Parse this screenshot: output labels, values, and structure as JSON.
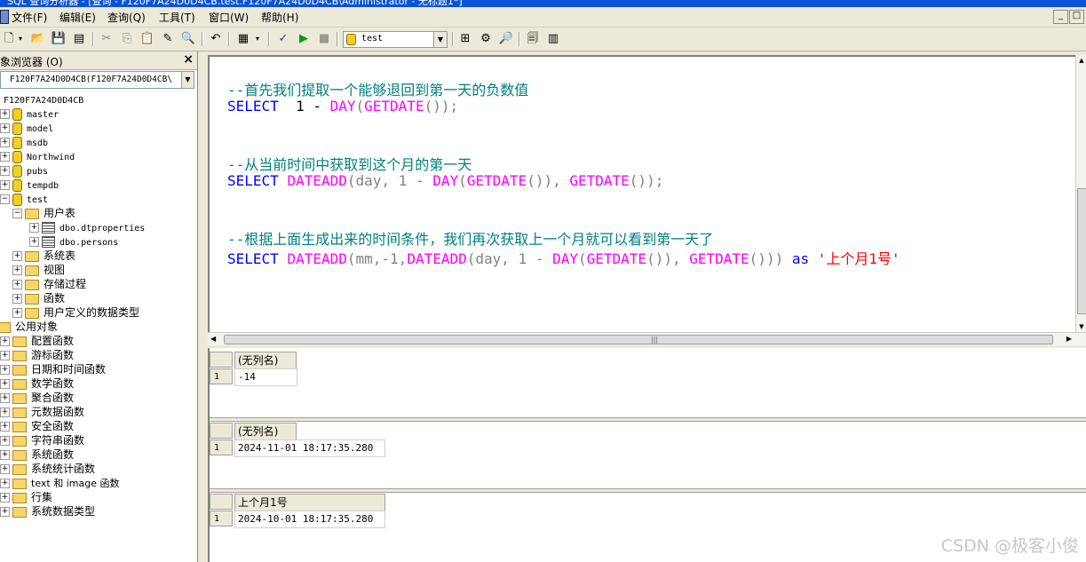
{
  "window": {
    "title": "SQL 查询分析器 - [查询 - F120F7A24D0D4CB.test.F120F7A24D0D4CB\\Administrator - 无标题1*]"
  },
  "menu": {
    "items": [
      "文件(F)",
      "编辑(E)",
      "查询(Q)",
      "工具(T)",
      "窗口(W)",
      "帮助(H)"
    ],
    "mdi_buttons": [
      "_",
      "□"
    ]
  },
  "toolbar": {
    "icons": [
      "new-query-icon",
      "open-icon",
      "save-icon",
      "insert-template-icon",
      "cut-icon",
      "copy-icon",
      "paste-icon",
      "clear-window-icon",
      "find-icon",
      "undo-icon",
      "results-mode-icon",
      "parse-icon",
      "execute-icon",
      "stop-icon",
      "object-search-icon",
      "execution-plan-icon",
      "index-tuning-icon",
      "properties-icon",
      "connection-info-icon"
    ],
    "database": "test"
  },
  "object_browser": {
    "title": "象浏览器 (O)",
    "close": "×",
    "server_combo": "F120F7A24D0D4CB(F120F7A24D0D4CB\\",
    "root": "F120F7A24D0D4CB",
    "databases": [
      "master",
      "model",
      "msdb",
      "Northwind",
      "pubs",
      "tempdb",
      "test"
    ],
    "test_children": {
      "user_tables": "用户表",
      "tables": [
        "dbo.dtproperties",
        "dbo.persons"
      ],
      "others": [
        "系统表",
        "视图",
        "存储过程",
        "函数",
        "用户定义的数据类型"
      ]
    },
    "common_objects": "公用对象",
    "common_children": [
      "配置函数",
      "游标函数",
      "日期和时间函数",
      "数学函数",
      "聚合函数",
      "元数据函数",
      "安全函数",
      "字符串函数",
      "系统函数",
      "系统统计函数",
      "text 和 image 函数",
      "行集",
      "系统数据类型"
    ]
  },
  "editor": {
    "line1_comment": "--首先我们提取一个能够退回到第一天的负数值",
    "line2": {
      "kw": "SELECT",
      "mid": "  1 - ",
      "fn": "DAY",
      "p1": "(",
      "fn2": "GETDATE",
      "p2": "());"
    },
    "line3_comment": "--从当前时间中获取到这个月的第一天",
    "line4": {
      "kw": "SELECT",
      "fn": "DATEADD",
      "a": "(day, 1 - ",
      "fn2": "DAY",
      "b": "(",
      "fn3": "GETDATE",
      "c": "()), ",
      "fn4": "GETDATE",
      "d": "());"
    },
    "line5_comment": "--根据上面生成出来的时间条件，我们再次获取上一个月就可以看到第一天了",
    "line6": {
      "kw": "SELECT",
      "fn": "DATEADD",
      "a": "(mm,-1,",
      "fn2": "DATEADD",
      "b": "(day, 1 - ",
      "fn3": "DAY",
      "c": "(",
      "fn4": "GETDATE",
      "d": "()), ",
      "fn5": "GETDATE",
      "e": "())) ",
      "kw2": "as",
      "str": " '上个月1号'"
    }
  },
  "results": [
    {
      "header": "(无列名)",
      "row_no": "1",
      "value": "-14"
    },
    {
      "header": "(无列名)",
      "row_no": "1",
      "value": "2024-11-01 18:17:35.280"
    },
    {
      "header": "上个月1号",
      "row_no": "1",
      "value": "2024-10-01 18:17:35.280"
    }
  ],
  "watermark": "CSDN @极客小俊"
}
